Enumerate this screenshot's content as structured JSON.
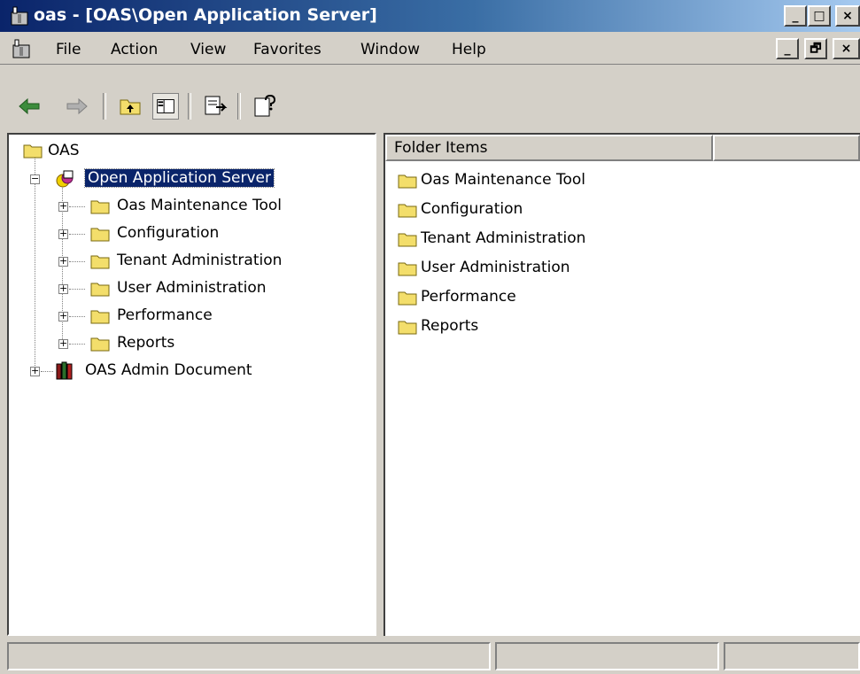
{
  "window": {
    "title": "oas - [OAS\\Open Application Server]",
    "title_bar_color": "#0a246a"
  },
  "window_buttons": {
    "minimize": "_",
    "maximize": "□",
    "close": "×"
  },
  "mdi_buttons": {
    "minimize": "_",
    "restore": "🗗",
    "close": "×"
  },
  "menu": [
    {
      "label": "File"
    },
    {
      "label": "Action"
    },
    {
      "label": "View"
    },
    {
      "label": "Favorites"
    },
    {
      "label": "Window"
    },
    {
      "label": "Help"
    }
  ],
  "toolbar": {
    "buttons": [
      "back-icon",
      "forward-icon",
      "up-folder-icon",
      "show-hide-tree-icon",
      "export-list-icon",
      "help-icon"
    ]
  },
  "tree": {
    "root": "OAS",
    "server": "Open Application Server",
    "children": [
      {
        "label": "Oas Maintenance Tool"
      },
      {
        "label": "Configuration"
      },
      {
        "label": "Tenant Administration"
      },
      {
        "label": "User Administration"
      },
      {
        "label": "Performance"
      },
      {
        "label": "Reports"
      }
    ],
    "admin_doc": "OAS Admin Document"
  },
  "list": {
    "column_header": "Folder Items",
    "items": [
      {
        "label": "Oas Maintenance Tool"
      },
      {
        "label": "Configuration"
      },
      {
        "label": "Tenant Administration"
      },
      {
        "label": "User Administration"
      },
      {
        "label": "Performance"
      },
      {
        "label": "Reports"
      }
    ]
  },
  "colors": {
    "folder": "#f3de6b",
    "selection": "#0a246a",
    "chrome": "#d4d0c8"
  }
}
